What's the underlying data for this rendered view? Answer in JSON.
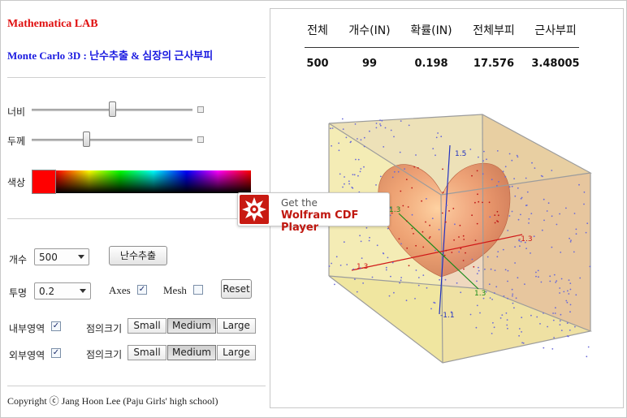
{
  "header": {
    "title": "Mathematica LAB",
    "subtitle": "Monte Carlo 3D : 난수추출 & 심장의 근사부피"
  },
  "controls": {
    "width_label": "너비",
    "thickness_label": "두께",
    "color_label": "색상",
    "count_label": "개수",
    "count_value": "500",
    "sample_button": "난수추출",
    "opacity_label": "투명",
    "opacity_value": "0.2",
    "axes_label": "Axes",
    "axes_checked": true,
    "mesh_label": "Mesh",
    "mesh_checked": false,
    "reset_button": "Reset",
    "inside_label": "내부영역",
    "inside_checked": true,
    "outside_label": "외부영역",
    "outside_checked": true,
    "point_size_label": "점의크기",
    "point_sizes": [
      "Small",
      "Medium",
      "Large"
    ],
    "inside_point_size": "Medium",
    "outside_point_size": "Medium",
    "selected_color": "#ff0000",
    "width_slider_fraction": 0.5,
    "thickness_slider_fraction": 0.34
  },
  "results": {
    "headers": [
      "전체",
      "개수(IN)",
      "확률(IN)",
      "전체부피",
      "근사부피"
    ],
    "values": [
      "500",
      "99",
      "0.198",
      "17.576",
      "3.48005"
    ]
  },
  "plot": {
    "axis_labels": {
      "z_top": "1.5",
      "z_bottom": "-1.1",
      "x_left": "1.3",
      "x_right": "-1.3",
      "y_left": "1.3",
      "y_right": "1.3",
      "y_mid": "-1.3"
    },
    "heart_color": "#e87050",
    "box_face_yellow": "#f2ea9a",
    "box_face_tan": "#e0b88a"
  },
  "cdf_badge": {
    "get_the": "Get the",
    "player_name": "Wolfram CDF Player"
  },
  "footer": {
    "copyright": "Copyright ⓒ Jang Hoon Lee (Paju Girls' high school)"
  }
}
